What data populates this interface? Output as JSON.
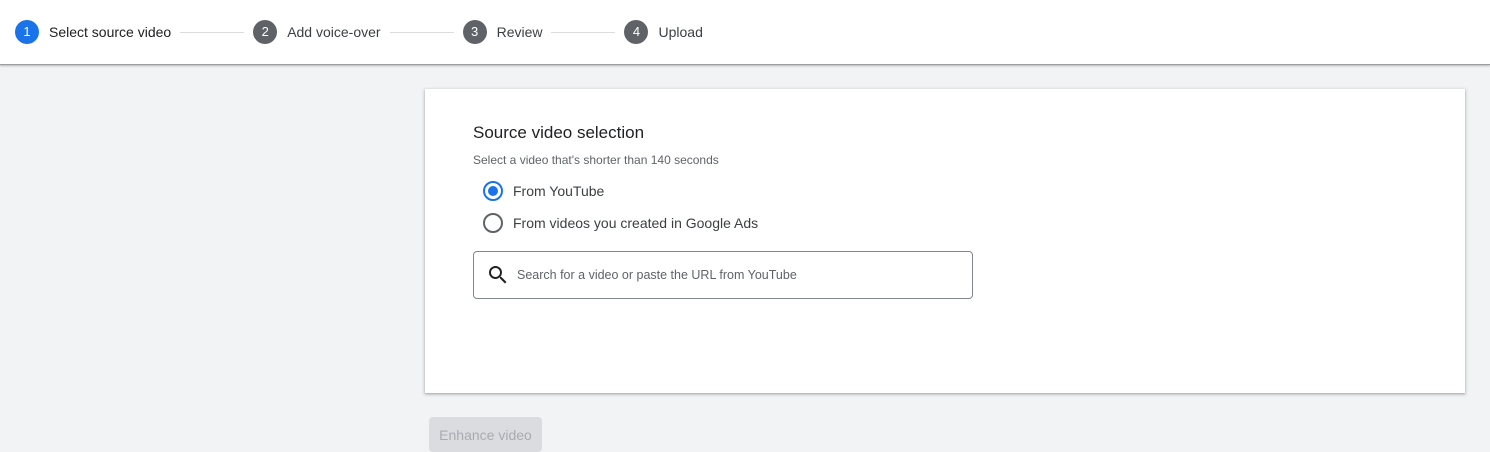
{
  "stepper": {
    "steps": [
      {
        "number": "1",
        "label": "Select source video",
        "state": "active"
      },
      {
        "number": "2",
        "label": "Add voice-over",
        "state": "pending"
      },
      {
        "number": "3",
        "label": "Review",
        "state": "pending"
      },
      {
        "number": "4",
        "label": "Upload",
        "state": "pending"
      }
    ]
  },
  "card": {
    "title": "Source video selection",
    "subtitle": "Select a video that's shorter than 140 seconds",
    "options": [
      {
        "label": "From YouTube",
        "checked": true
      },
      {
        "label": "From videos you created in Google Ads",
        "checked": false
      }
    ],
    "search": {
      "icon": "search-icon",
      "value": "",
      "placeholder": "Search for a video or paste the URL from YouTube"
    }
  },
  "actions": {
    "enhance_label": "Enhance video",
    "enhance_enabled": false
  },
  "colors": {
    "accent": "#1a73e8",
    "step_inactive": "#5f6368",
    "background": "#f1f3f4",
    "disabled_button": "#dadce0"
  }
}
